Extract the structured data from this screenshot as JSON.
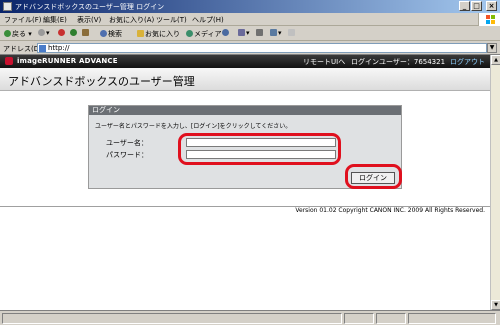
{
  "window": {
    "title": "アドバンスドボックスのユーザー管理 ログイン"
  },
  "menu": {
    "items": [
      "ファイル(F)",
      "編集(E)",
      "表示(V)",
      "お気に入り(A)",
      "ツール(T)",
      "ヘルプ(H)"
    ]
  },
  "toolbar": {
    "back_label": "戻る",
    "search_label": "検索",
    "favorites_label": "お気に入り",
    "media_label": "メディア"
  },
  "address": {
    "label": "アドレス(D)",
    "url": "http://"
  },
  "header": {
    "brand": "imageRUNNER ADVANCE",
    "remote_ui_link": "リモートUIへ",
    "login_user": "ログインユーザー：7654321",
    "logout_link": "ログアウト"
  },
  "page": {
    "title": "アドバンスドボックスのユーザー管理"
  },
  "login": {
    "panel_title": "ログイン",
    "instructions": "ユーザー名とパスワードを入力し、[ログイン]をクリックしてください。",
    "username_label": "ユーザー名：",
    "username_value": "",
    "password_label": "パスワード：",
    "password_value": "",
    "submit_label": "ログイン"
  },
  "footer": {
    "version": "Version 01.02 Copyright CANON INC. 2009 All Rights Reserved."
  },
  "colors": {
    "highlight": "#e0101e",
    "titlebar": "#0a246a",
    "panel_header": "#6b6f74"
  }
}
